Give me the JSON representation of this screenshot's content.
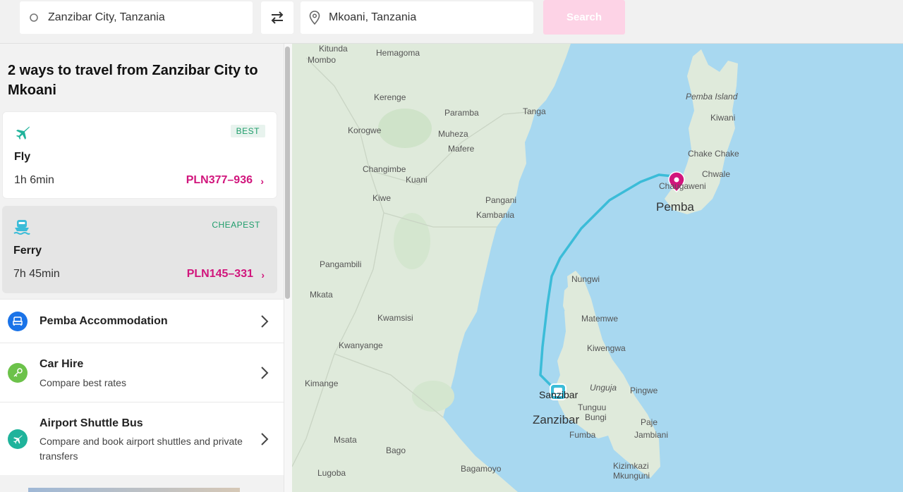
{
  "search": {
    "from_value": "Zanzibar City, Tanzania",
    "to_value": "Mkoani, Tanzania",
    "search_label": "Search"
  },
  "results": {
    "heading": "2 ways to travel from Zanzibar City to Mkoani",
    "options": [
      {
        "mode": "Fly",
        "badge": "BEST",
        "duration": "1h 6min",
        "price": "PLN377–936",
        "icon": "plane-icon"
      },
      {
        "mode": "Ferry",
        "badge": "CHEAPEST",
        "duration": "7h 45min",
        "price": "PLN145–331",
        "icon": "ferry-icon"
      }
    ]
  },
  "extras": [
    {
      "title": "Pemba Accommodation",
      "subtitle": "",
      "icon": "bed-icon",
      "color": "#1a73e8"
    },
    {
      "title": "Car Hire",
      "subtitle": "Compare best rates",
      "icon": "car-key-icon",
      "color": "#6cc24a"
    },
    {
      "title": "Airport Shuttle Bus",
      "subtitle": "Compare and book airport shuttles and private transfers",
      "icon": "plane-icon",
      "color": "#1fb39b"
    }
  ],
  "map": {
    "labels": {
      "kitunda": "Kitunda",
      "mombo": "Mombo",
      "hemagoma": "Hemagoma",
      "kerenge": "Kerenge",
      "paramba": "Paramba",
      "tanga": "Tanga",
      "korogwe": "Korogwe",
      "muheza": "Muheza",
      "mafere": "Mafere",
      "changimbe": "Changimbe",
      "kuani": "Kuani",
      "kiwe": "Kiwe",
      "pangani": "Pangani",
      "kambania": "Kambania",
      "pangambili": "Pangambili",
      "mkata": "Mkata",
      "kwamsisi": "Kwamsisi",
      "kwanyange": "Kwanyange",
      "kimange": "Kimange",
      "msata": "Msata",
      "bago": "Bago",
      "lugoba": "Lugoba",
      "bagamoyo": "Bagamoyo",
      "pemba_island": "Pemba Island",
      "kiwani": "Kiwani",
      "chake_chake": "Chake Chake",
      "chwale": "Chwale",
      "chaugaweni": "Chaugaweni",
      "pemba": "Pemba",
      "nungwi": "Nungwi",
      "matemwe": "Matemwe",
      "kiwengwa": "Kiwengwa",
      "unguja": "Unguja",
      "pingwe": "Pingwe",
      "zanzibar_city": "Sanzibar",
      "zanzibar": "Zanzibar",
      "tunguu": "Tunguu",
      "bungi": "Bungi",
      "paje": "Paje",
      "jambiani": "Jambiani",
      "fumba": "Fumba",
      "kizimkazi": "Kizimkazi",
      "mkunguni": "Mkunguni"
    },
    "colors": {
      "sea": "#a8d8f0",
      "land": "#dfeadb",
      "route": "#3bbcd8",
      "pin": "#d1157c"
    }
  }
}
